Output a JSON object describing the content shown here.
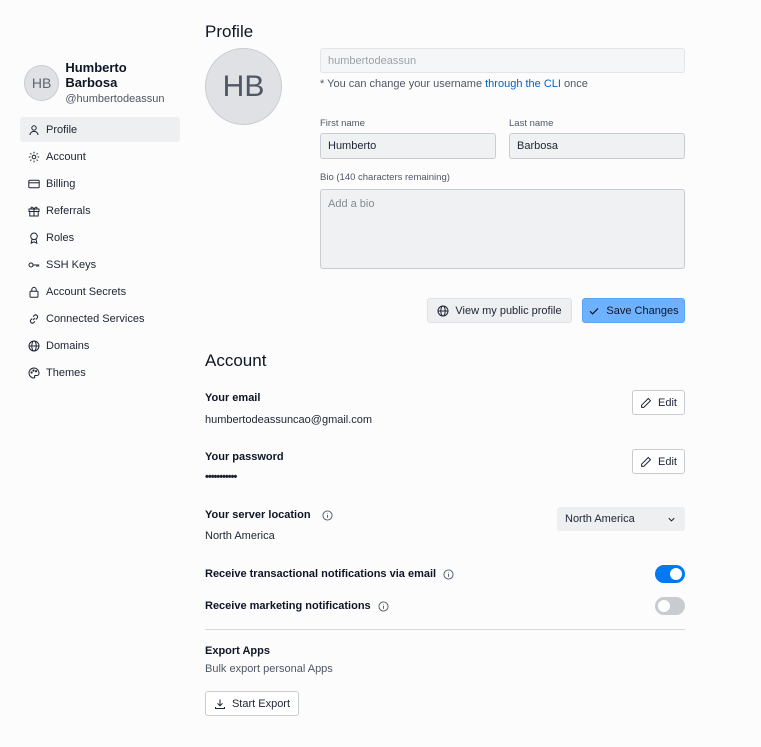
{
  "user": {
    "initials": "HB",
    "name": "Humberto Barbosa",
    "handle": "@humbertodeassun"
  },
  "sidebar": {
    "items": [
      {
        "label": "Profile",
        "icon": "user-icon"
      },
      {
        "label": "Account",
        "icon": "gear-icon"
      },
      {
        "label": "Billing",
        "icon": "credit-card-icon"
      },
      {
        "label": "Referrals",
        "icon": "gift-icon"
      },
      {
        "label": "Roles",
        "icon": "badge-icon"
      },
      {
        "label": "SSH Keys",
        "icon": "key-icon"
      },
      {
        "label": "Account Secrets",
        "icon": "lock-icon"
      },
      {
        "label": "Connected Services",
        "icon": "link-icon"
      },
      {
        "label": "Domains",
        "icon": "globe-icon"
      },
      {
        "label": "Themes",
        "icon": "palette-icon"
      }
    ],
    "active": "Profile"
  },
  "profile": {
    "title": "Profile",
    "username_value": "humbertodeassun",
    "username_note_prefix": "* You can change your username",
    "username_note_link": "through the CLI",
    "username_note_suffix": "once",
    "first_name_label": "First name",
    "first_name_value": "Humberto",
    "last_name_label": "Last name",
    "last_name_value": "Barbosa",
    "bio_label": "Bio (140 characters remaining)",
    "bio_placeholder": "Add a bio",
    "view_profile_label": "View my public profile",
    "save_label": "Save Changes"
  },
  "account": {
    "title": "Account",
    "email_title": "Your email",
    "email_value": "humbertodeassuncao@gmail.com",
    "password_title": "Your password",
    "password_value": "•••••••••••",
    "edit_label": "Edit",
    "server_location_title": "Your server location",
    "server_location_value": "North America",
    "server_location_select": "North America",
    "transactional_label": "Receive transactional notifications via email",
    "transactional_on": true,
    "marketing_label": "Receive marketing notifications",
    "marketing_on": false,
    "export_title": "Export Apps",
    "export_subtitle": "Bulk export personal Apps",
    "export_button": "Start Export"
  },
  "colors": {
    "accent": "#0079f2",
    "primary_button": "#6eb2ff",
    "toggle_off": "#c8cbd0"
  }
}
